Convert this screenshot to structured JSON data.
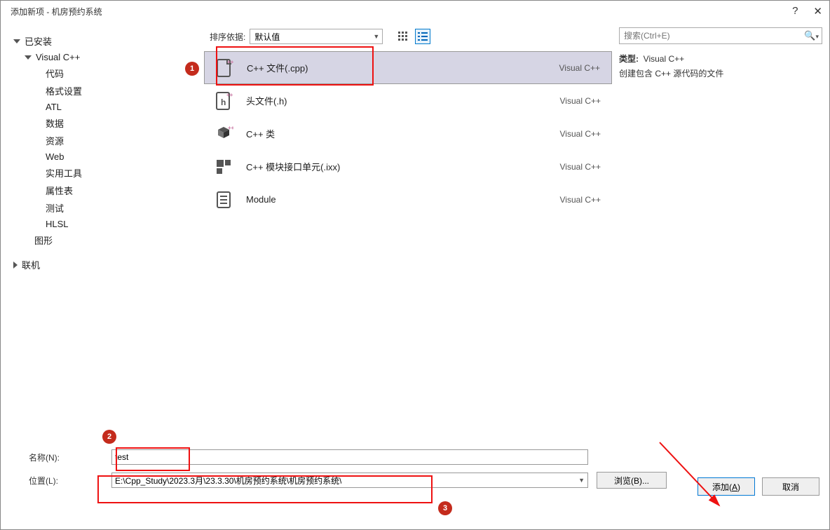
{
  "titlebar": {
    "title": "添加新项 - 机房预约系统",
    "help": "?",
    "close": "✕"
  },
  "sidebar": {
    "installed": "已安装",
    "vcpp": "Visual C++",
    "items": [
      "代码",
      "格式设置",
      "ATL",
      "数据",
      "资源",
      "Web",
      "实用工具",
      "属性表",
      "测试",
      "HLSL"
    ],
    "graphics": "图形",
    "online": "联机"
  },
  "sortbar": {
    "label": "排序依据:",
    "value": "默认值"
  },
  "templates": [
    {
      "name": "C++ 文件(.cpp)",
      "lang": "Visual C++"
    },
    {
      "name": "头文件(.h)",
      "lang": "Visual C++"
    },
    {
      "name": "C++ 类",
      "lang": "Visual C++"
    },
    {
      "name": "C++ 模块接口单元(.ixx)",
      "lang": "Visual C++"
    },
    {
      "name": "Module",
      "lang": "Visual C++"
    }
  ],
  "right": {
    "search_placeholder": "搜索(Ctrl+E)",
    "type_label": "类型:",
    "type_value": "Visual C++",
    "desc": "创建包含 C++ 源代码的文件"
  },
  "form": {
    "name_label": "名称(N):",
    "name_value": "test",
    "loc_label": "位置(L):",
    "loc_value": "E:\\Cpp_Study\\2023.3月\\23.3.30\\机房预约系统\\机房预约系统\\",
    "browse": "浏览(B)..."
  },
  "actions": {
    "add": "添加(A)",
    "cancel": "取消"
  },
  "annotations": {
    "n1": "1",
    "n2": "2",
    "n3": "3"
  }
}
